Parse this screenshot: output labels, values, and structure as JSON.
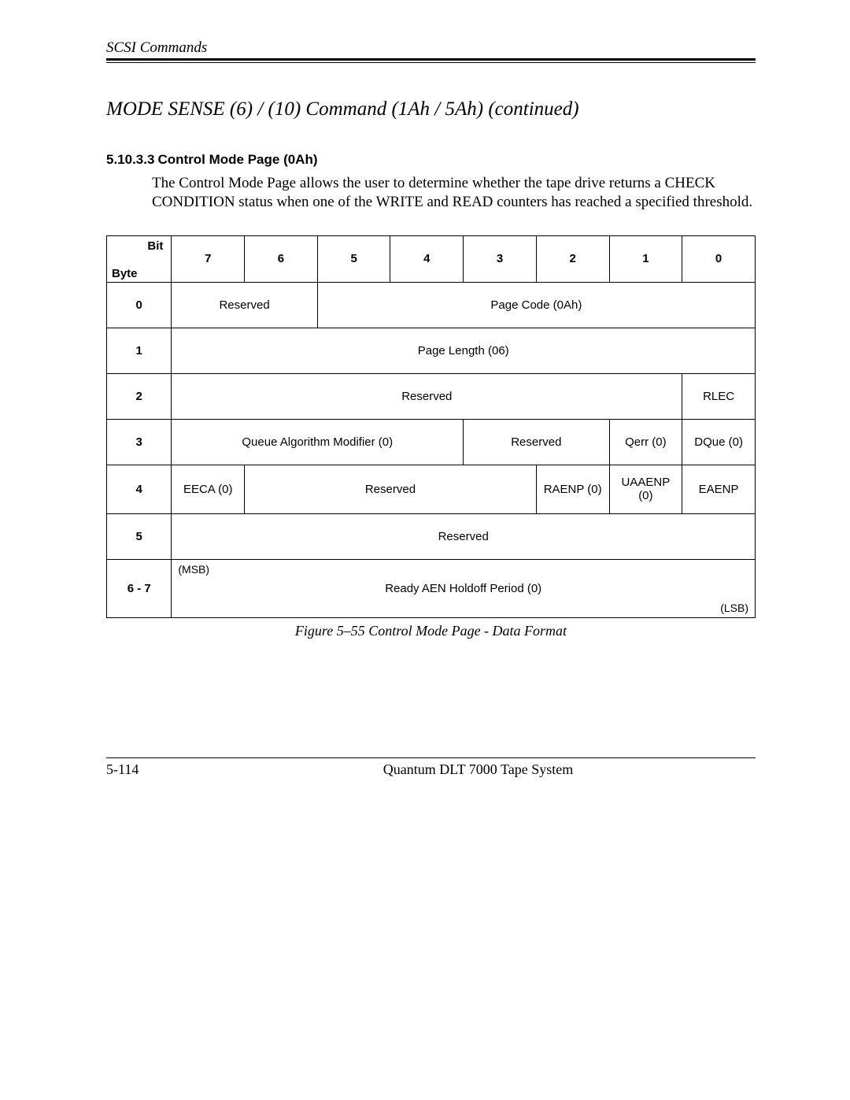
{
  "header": {
    "running": "SCSI Commands"
  },
  "title": "MODE SENSE  (6) / (10) Command  (1Ah / 5Ah) (continued)",
  "subsection": {
    "number": "5.10.3.3",
    "title": "Control Mode Page (0Ah)"
  },
  "paragraph": "The Control Mode Page allows the user to determine whether the tape drive returns a CHECK CONDITION status when one of the WRITE and READ counters has reached a specified threshold.",
  "table": {
    "corner_bit": "Bit",
    "corner_byte": "Byte",
    "bits": [
      "7",
      "6",
      "5",
      "4",
      "3",
      "2",
      "1",
      "0"
    ],
    "rows": {
      "r0": {
        "byte": "0",
        "reserved": "Reserved",
        "pagecode": "Page Code (0Ah)"
      },
      "r1": {
        "byte": "1",
        "pagelen": "Page Length (06)"
      },
      "r2": {
        "byte": "2",
        "reserved": "Reserved",
        "rlec": "RLEC"
      },
      "r3": {
        "byte": "3",
        "qam": "Queue Algorithm Modifier (0)",
        "reserved": "Reserved",
        "qerr": "Qerr (0)",
        "dque": "DQue (0)"
      },
      "r4": {
        "byte": "4",
        "eeca": "EECA (0)",
        "reserved": "Reserved",
        "raenp": "RAENP (0)",
        "uaaenp": "UAAENP (0)",
        "eaenp": "EAENP"
      },
      "r5": {
        "byte": "5",
        "reserved": "Reserved"
      },
      "r6": {
        "byte": "6 - 7",
        "msb": "(MSB)",
        "center": "Ready AEN Holdoff Period (0)",
        "lsb": "(LSB)"
      }
    }
  },
  "caption": "Figure 5–55  Control Mode Page  - Data Format",
  "footer": {
    "page": "5-114",
    "center": "Quantum DLT 7000 Tape System"
  }
}
